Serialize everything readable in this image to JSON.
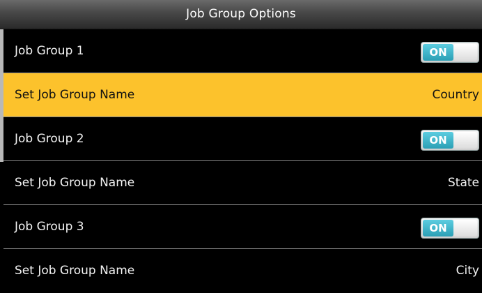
{
  "window": {
    "title": "Job Group Options"
  },
  "rows": [
    {
      "label": "Job Group 1",
      "toggle": {
        "state": "ON",
        "on": true
      }
    },
    {
      "label": "Set Job Group Name",
      "value": "Country",
      "selected": true
    },
    {
      "label": "Job Group 2",
      "toggle": {
        "state": "ON",
        "on": true
      }
    },
    {
      "label": "Set Job Group Name",
      "value": "State"
    },
    {
      "label": "Job Group 3",
      "toggle": {
        "state": "ON",
        "on": true
      }
    },
    {
      "label": "Set Job Group Name",
      "value": "City"
    }
  ],
  "colors": {
    "selection": "#fcc22c",
    "toggle_on": "#2b9fb5",
    "background": "#000000"
  }
}
